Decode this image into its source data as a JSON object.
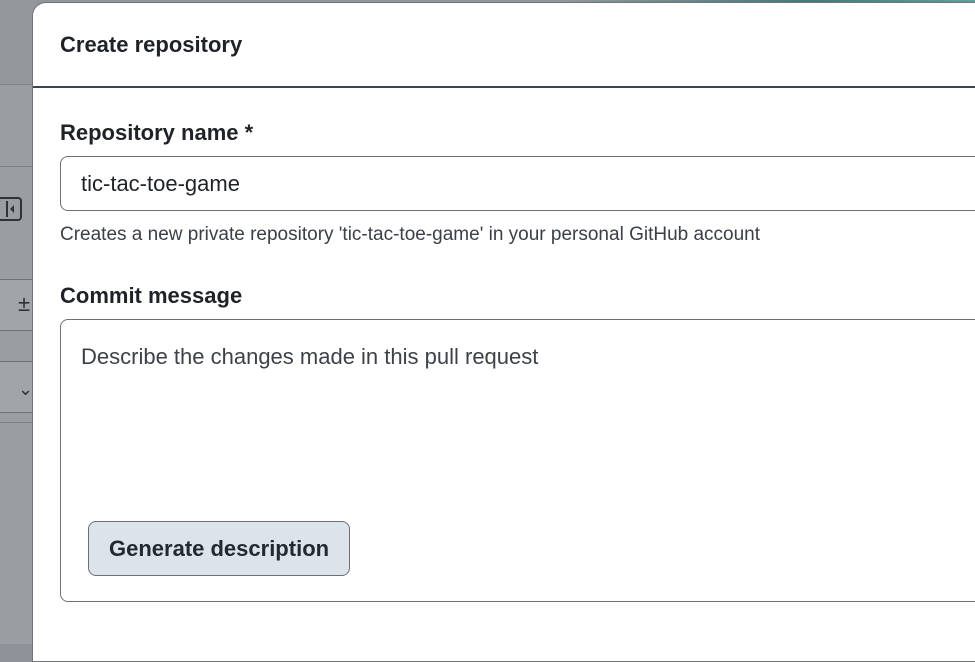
{
  "background": {
    "icons": [
      "panel-collapse-icon",
      "diff-icon",
      "chevron-down-icon"
    ],
    "accent_color": "#3f7b77"
  },
  "dialog": {
    "title": "Create repository"
  },
  "repo_name": {
    "label": "Repository name *",
    "value": "tic-tac-toe-game",
    "help": "Creates a new private repository 'tic-tac-toe-game' in your personal GitHub account"
  },
  "commit": {
    "label": "Commit message",
    "placeholder": "Describe the changes made in this pull request",
    "generate_button": "Generate description"
  },
  "colors": {
    "button_bg": "#dde3ea",
    "text": "#1f2328",
    "overlay": "#9a9ea3"
  }
}
